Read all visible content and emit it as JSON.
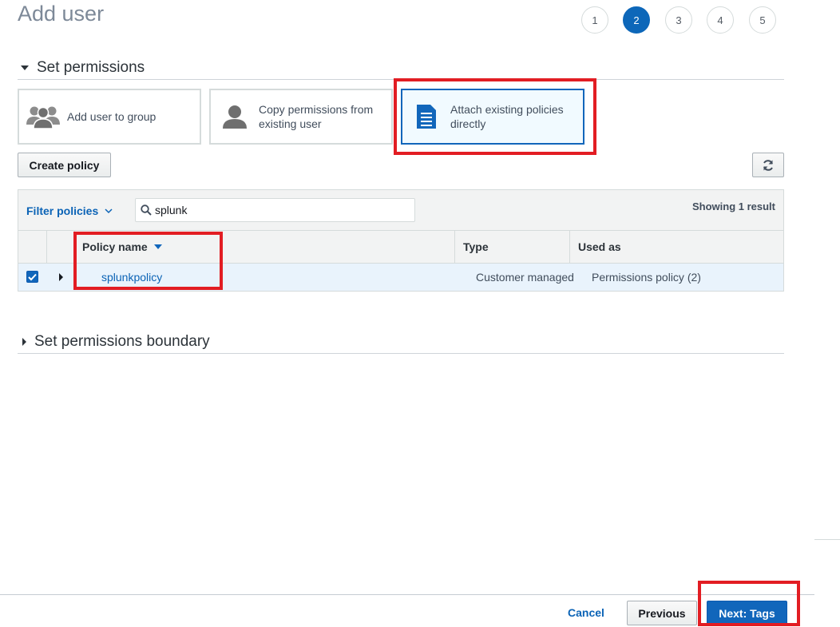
{
  "page": {
    "title": "Add user"
  },
  "steps": [
    {
      "label": "1",
      "active": false
    },
    {
      "label": "2",
      "active": true
    },
    {
      "label": "3",
      "active": false
    },
    {
      "label": "4",
      "active": false
    },
    {
      "label": "5",
      "active": false
    }
  ],
  "permissions": {
    "section_title": "Set permissions",
    "options": {
      "group": {
        "label": "Add user to group",
        "icon": "user-group-icon"
      },
      "copy": {
        "label_line1": "Copy permissions from",
        "label_line2": "existing user",
        "icon": "user-icon"
      },
      "attach": {
        "label_line1": "Attach existing policies",
        "label_line2": "directly",
        "icon": "document-icon",
        "selected": true
      }
    },
    "create_policy_label": "Create policy",
    "refresh_icon": "refresh-icon"
  },
  "table": {
    "filter_label": "Filter policies",
    "search_value": "splunk",
    "result_count": "Showing 1 result",
    "columns": {
      "policy_name": "Policy name",
      "type": "Type",
      "used_as": "Used as"
    },
    "rows": [
      {
        "checked": true,
        "name": "splunkpolicy",
        "type": "Customer managed",
        "used_as": "Permissions policy (2)"
      }
    ]
  },
  "boundary": {
    "section_title": "Set permissions boundary"
  },
  "footer": {
    "cancel_label": "Cancel",
    "previous_label": "Previous",
    "next_label": "Next: Tags"
  },
  "colors": {
    "accent": "#1166bb",
    "annotation": "#e21d23",
    "selected_row": "#e9f3fc"
  }
}
